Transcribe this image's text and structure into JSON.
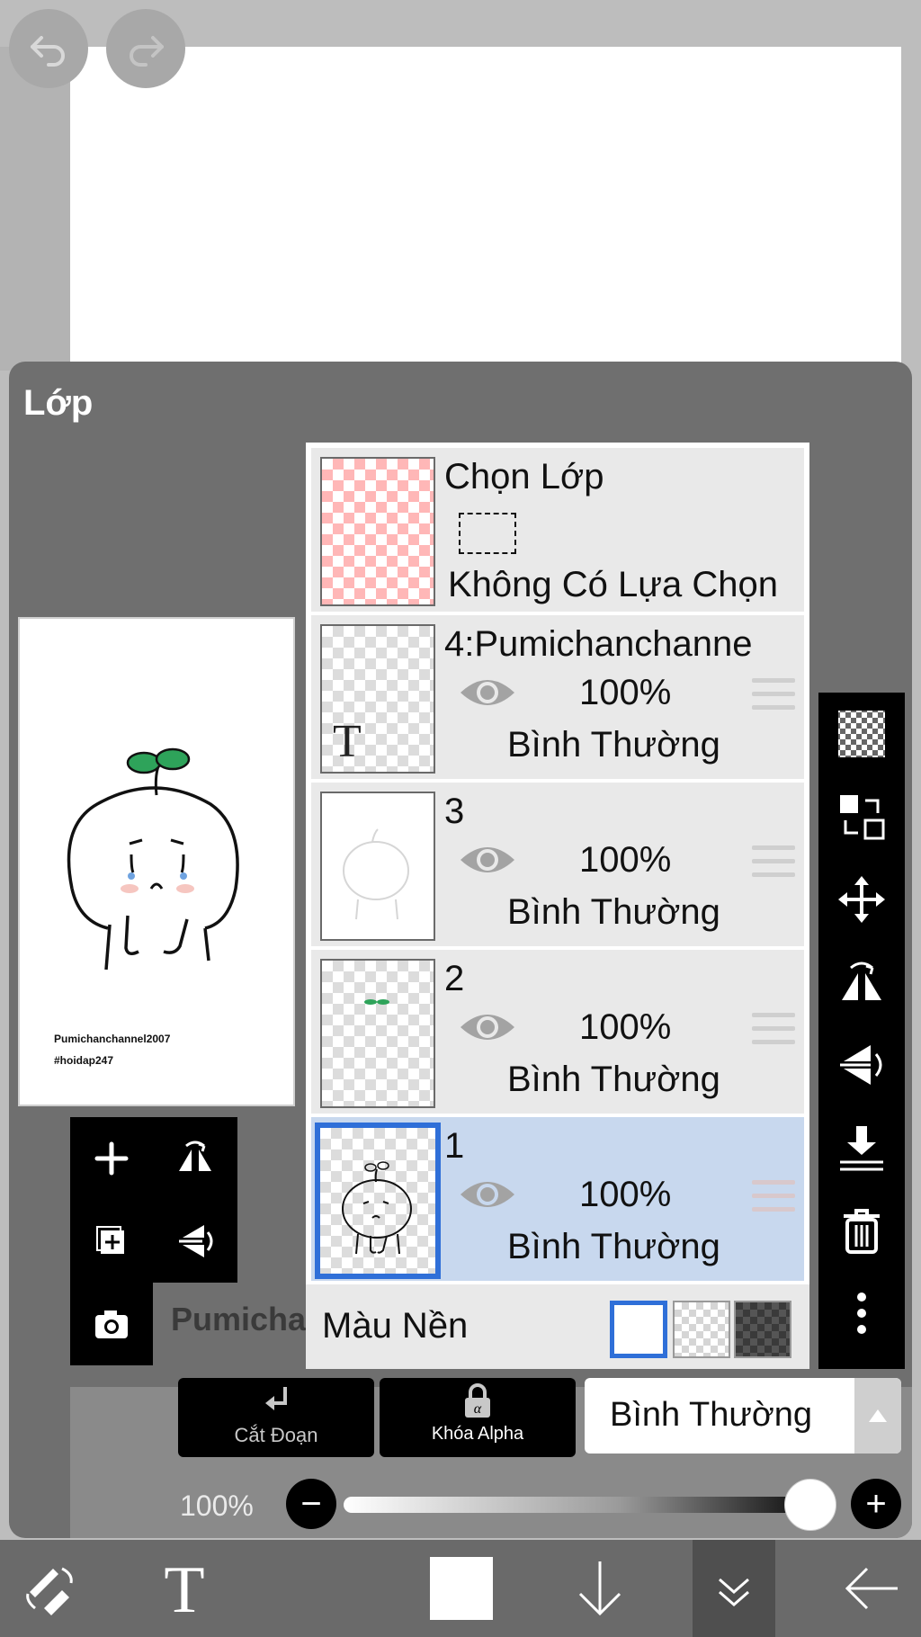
{
  "panel": {
    "title": "Lớp",
    "preview_caption_1": "Pumichanchannel2007",
    "preview_caption_2": "#hoidap247",
    "behind_text": "Pumicha"
  },
  "selection_row": {
    "title": "Chọn Lớp",
    "status": "Không Có Lựa Chọn"
  },
  "layers": [
    {
      "name": "4:Pumichanchanne",
      "opacity": "100%",
      "blend_mode": "Bình Thường",
      "selected": false
    },
    {
      "name": "3",
      "opacity": "100%",
      "blend_mode": "Bình Thường",
      "selected": false
    },
    {
      "name": "2",
      "opacity": "100%",
      "blend_mode": "Bình Thường",
      "selected": false
    },
    {
      "name": "1",
      "opacity": "100%",
      "blend_mode": "Bình Thường",
      "selected": true
    }
  ],
  "background_row": {
    "label": "Màu Nền",
    "options": [
      "white",
      "transparent",
      "dark"
    ],
    "selected": "white"
  },
  "actions": {
    "clip_label": "Cắt Đoạn",
    "alpha_lock_label": "Khóa Alpha",
    "blend_mode_value": "Bình Thường"
  },
  "opacity_slider": {
    "label": "100%",
    "value": 1.0,
    "minus": "−",
    "plus": "+"
  },
  "colors": {
    "accent": "#2f6fd8",
    "selected_row": "#c8d8ee",
    "panel": "#6f6f6f",
    "toolbar": "#000000"
  },
  "icons": {
    "top": [
      "undo-icon",
      "redo-icon"
    ],
    "left_tools": [
      "add-layer-icon",
      "flip-horizontal-icon",
      "duplicate-layer-icon",
      "flip-vertical-icon",
      "camera-icon"
    ],
    "right_tools": [
      "transparency-icon",
      "swap-layers-icon",
      "move-icon",
      "flip-horizontal-icon",
      "flip-vertical-icon",
      "merge-down-icon",
      "trash-icon",
      "more-icon"
    ],
    "bottom": [
      "tool-switch-icon",
      "text-tool-icon",
      "color-swatch-icon",
      "download-icon",
      "collapse-icon",
      "back-icon"
    ]
  }
}
